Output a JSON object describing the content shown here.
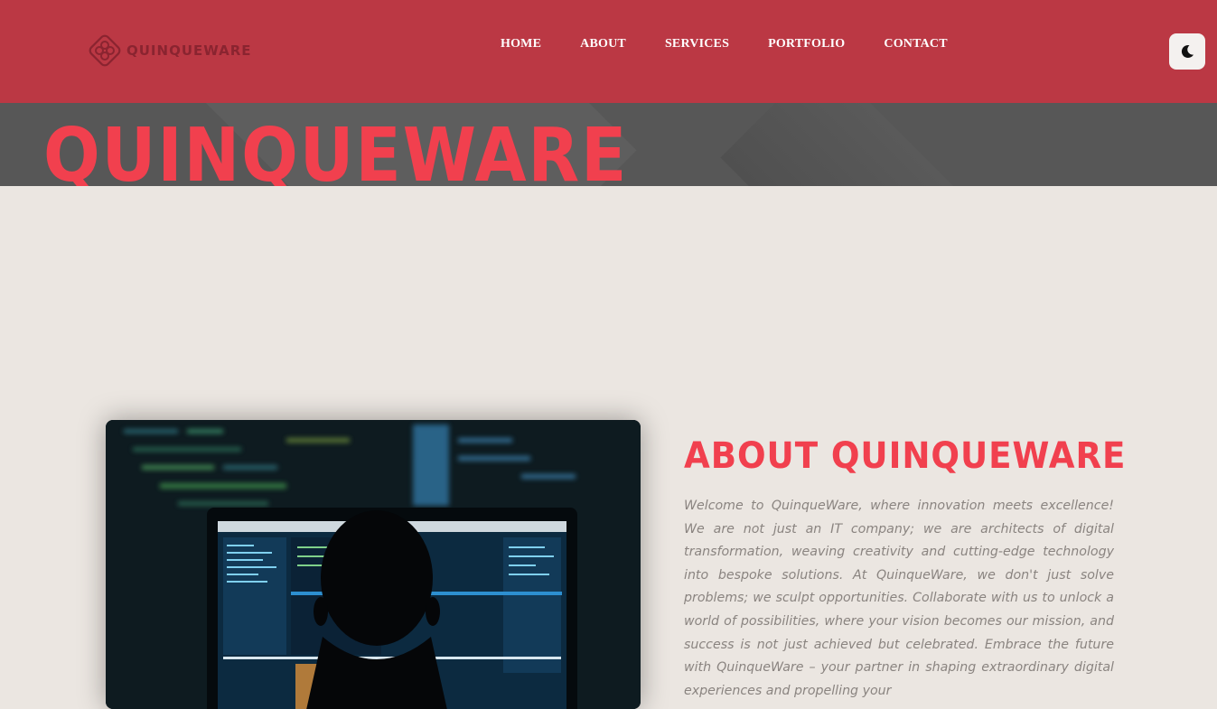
{
  "header": {
    "logo_text": "QUINQUEWARE",
    "nav": [
      {
        "label": "HOME"
      },
      {
        "label": "ABOUT"
      },
      {
        "label": "SERVICES"
      },
      {
        "label": "PORTFOLIO"
      },
      {
        "label": "CONTACT"
      }
    ],
    "theme_toggle_icon": "moon-icon"
  },
  "hero": {
    "title": "QUINQUEWARE"
  },
  "about": {
    "heading": "ABOUT QUINQUEWARE",
    "image_icon": "person-at-laptop-image",
    "paragraph": "Welcome to QuinqueWare, where innovation meets excellence! We are not just an IT company; we are architects of digital transformation, weaving creativity and cutting-edge technology into bespoke solutions. At QuinqueWare, we don't just solve problems; we sculpt opportunities. Collaborate with us to unlock a world of possibilities, where your vision becomes our mission, and success is not just achieved but celebrated. Embrace the future with QuinqueWare – your partner in shaping extraordinary digital experiences and propelling your"
  },
  "colors": {
    "header_bg": "#bb3844",
    "accent": "#f1404e",
    "hero_bg": "#575757",
    "page_bg": "#ebe6e1"
  }
}
